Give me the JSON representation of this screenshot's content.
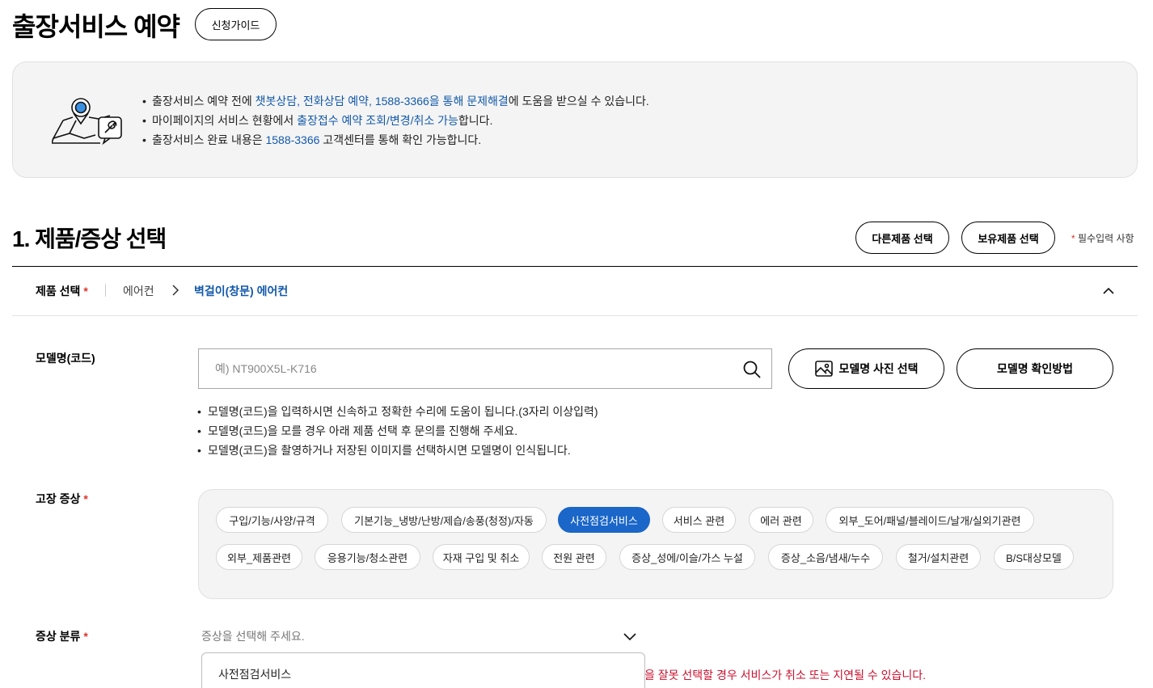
{
  "header": {
    "title": "출장서비스 예약",
    "guide_button": "신청가이드"
  },
  "notice": {
    "icon": "map-pin-wrench-icon",
    "lines": [
      {
        "prefix": "출장서비스 예약 전에 ",
        "highlight": "챗봇상담, 전화상담 예약, 1588-3366을 통해 문제해결",
        "suffix": "에 도움을 받으실 수 있습니다."
      },
      {
        "prefix": "마이페이지의 서비스 현황에서 ",
        "highlight": "출장접수 예약 조회/변경/취소 가능",
        "suffix": "합니다."
      },
      {
        "prefix": "출장서비스 완료 내용은 ",
        "highlight": "1588-3366",
        "suffix": " 고객센터를 통해 확인 가능합니다."
      }
    ]
  },
  "section": {
    "title": "1. 제품/증상 선택",
    "other_product_button": "다른제품 선택",
    "owned_product_button": "보유제품 선택",
    "required_mark": "*",
    "required_note": " 필수입력 사항"
  },
  "product": {
    "label": "제품 선택",
    "required_mark": "*",
    "category": "에어컨",
    "item": "벽걸이(창문) 에어컨"
  },
  "model": {
    "label": "모델명(코드)",
    "placeholder": "예) NT900X5L-K716",
    "value": "",
    "photo_button": "모델명 사진 선택",
    "howto_button": "모델명 확인방법",
    "notes": [
      "모델명(코드)을 입력하시면 신속하고 정확한 수리에 도움이 됩니다.(3자리 이상입력)",
      "모델명(코드)을 모를 경우 아래 제품 선택 후 문의를 진행해 주세요.",
      "모델명(코드)을 촬영하거나 저장된 이미지를 선택하시면 모델명이 인식됩니다."
    ]
  },
  "symptom": {
    "label": "고장 증상",
    "required_mark": "*",
    "selected": "사전점검서비스",
    "chips": [
      "구입/기능/사양/규격",
      "기본기능_냉방/난방/제습/송풍(청정)/자동",
      "사전점검서비스",
      "서비스 관련",
      "에러 관련",
      "외부_도어/패널/블레이드/날개/실외기관련",
      "외부_제품관련",
      "응용기능/청소관련",
      "자재 구입 및 취소",
      "전원 관련",
      "증상_성에/이슬/가스 누설",
      "증상_소음/냄새/누수",
      "철거/설치관련",
      "B/S대상모델"
    ]
  },
  "category": {
    "label": "증상 분류",
    "required_mark": "*",
    "placeholder": "증상을 선택해 주세요.",
    "option": "사전점검서비스",
    "warning": "을 잘못 선택할 경우 서비스가 취소 또는 지연될 수 있습니다."
  },
  "colors": {
    "accent": "#1a66c9",
    "highlight_text": "#1259aa",
    "required": "#e0312b",
    "warning": "#c8102e",
    "panel_bg": "#f4f4f4"
  }
}
